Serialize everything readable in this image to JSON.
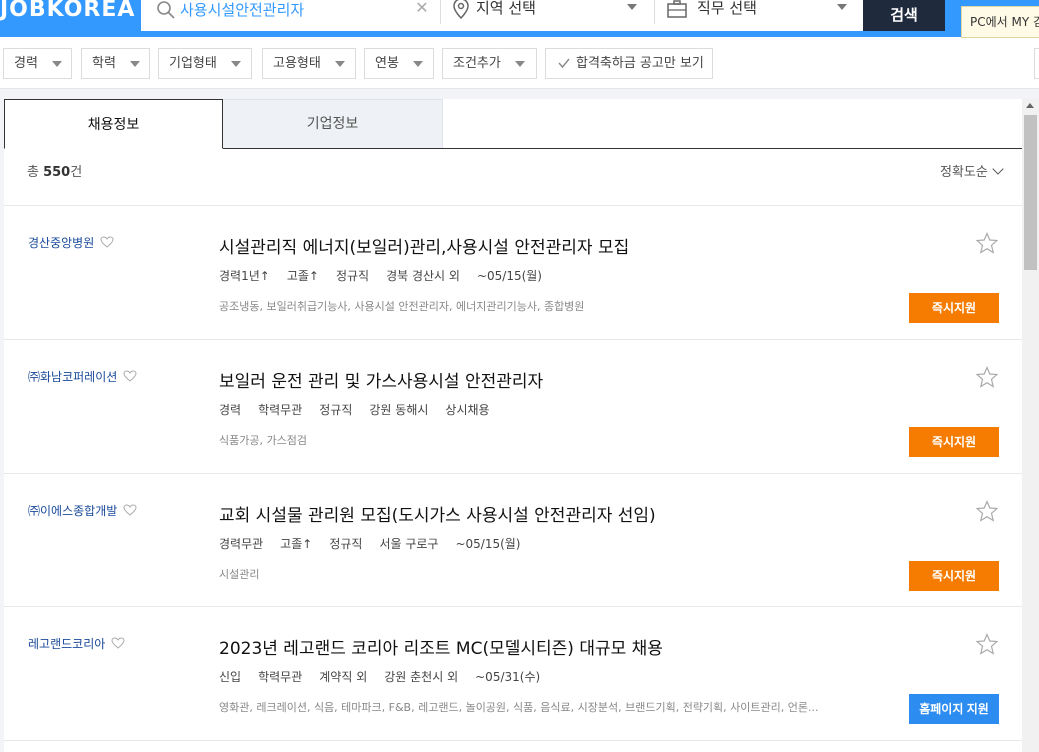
{
  "header": {
    "logo": "JOBKOREA",
    "search": {
      "value": "사용시설안전관리자",
      "placeholder": ""
    },
    "region_label": "지역 선택",
    "job_label": "직무 선택",
    "search_button": "검색",
    "pc_tip": "PC에서 MY 검색"
  },
  "filters": {
    "items": [
      "경력",
      "학력",
      "기업형태",
      "고용형태",
      "연봉",
      "조건추가"
    ],
    "passed_only": "합격축하금 공고만 보기"
  },
  "tabs": {
    "active": "채용정보",
    "other": "기업정보"
  },
  "summary": {
    "prefix": "총 ",
    "count": "550",
    "suffix": "건",
    "sort": "정확도순"
  },
  "jobs": [
    {
      "company": "경산중앙병원",
      "title": "시설관리직 에너지(보일러)관리,사용시설 안전관리자 모집",
      "meta": [
        "경력1년↑",
        "고졸↑",
        "정규직",
        "경북 경산시 외",
        "~05/15(월)"
      ],
      "tags": "공조냉동, 보일러취급기능사, 사용시설 안전관리자, 에너지관리기능사, 종합병원",
      "apply": "즉시지원"
    },
    {
      "company": "㈜화남코퍼레이션",
      "title": "보일러 운전 관리 및 가스사용시설 안전관리자",
      "meta": [
        "경력",
        "학력무관",
        "정규직",
        "강원 동해시",
        "상시채용"
      ],
      "tags": "식품가공, 가스점검",
      "apply": "즉시지원"
    },
    {
      "company": "㈜이에스종합개발",
      "title": "교회 시설물 관리원 모집(도시가스 사용시설 안전관리자 선임)",
      "meta": [
        "경력무관",
        "고졸↑",
        "정규직",
        "서울 구로구",
        "~05/15(월)"
      ],
      "tags": "시설관리",
      "apply": "즉시지원"
    },
    {
      "company": "레고랜드코리아",
      "title": "2023년 레고랜드 코리아 리조트 MC(모델시티즌) 대규모 채용",
      "meta": [
        "신입",
        "학력무관",
        "계약직 외",
        "강원 춘천시 외",
        "~05/31(수)"
      ],
      "tags": "영화관, 레크레이션, 식음, 테마파크, F&B, 레고랜드, 놀이공원, 식품, 음식료, 시장분석, 브랜드기획, 전략기획, 사이트관리, 언론...",
      "apply": "홈페이지 지원"
    }
  ],
  "colors": {
    "brand": "#3399ff",
    "apply": "#f57c00",
    "homepage_apply": "#2d8cf0",
    "company": "#1a4a9a"
  }
}
